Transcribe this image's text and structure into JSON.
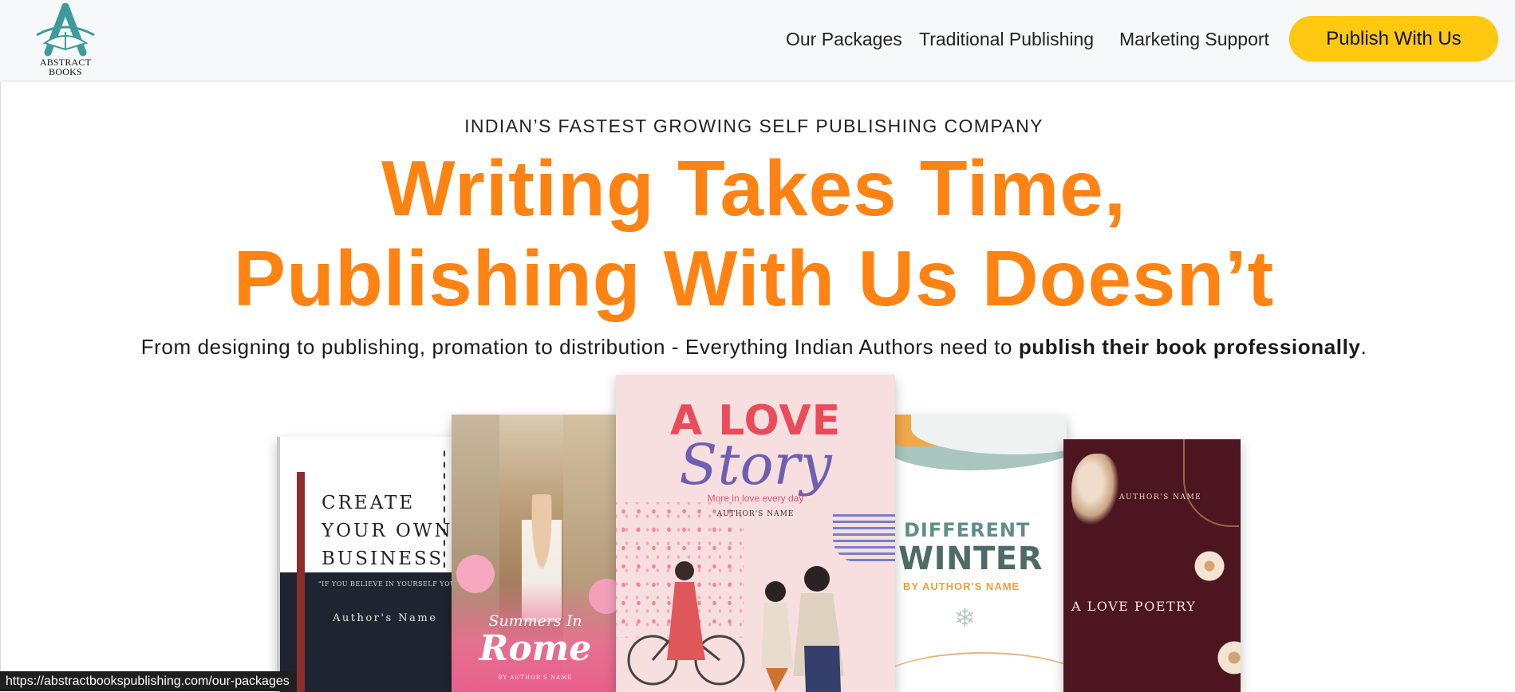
{
  "brand": {
    "logo_line1": "ABSTRACT",
    "logo_line2": "BOOKS",
    "accent": "#3d9b9b"
  },
  "nav": {
    "links": [
      "Our Packages",
      "Traditional Publishing",
      "Marketing Support"
    ],
    "cta": "Publish With Us",
    "cta_color": "#fdc80f"
  },
  "hero": {
    "eyebrow": "INDIAN’S FASTEST GROWING SELF PUBLISHING COMPANY",
    "headline_line1": "Writing Takes Time,",
    "headline_line2": "Publishing With Us Doesn’t",
    "headline_color": "#ff8313",
    "subtext_plain": "From designing to publishing, promation to distribution - Everything Indian Authors need to ",
    "subtext_bold": "publish their book professionally",
    "subtext_end": "."
  },
  "books": {
    "business": {
      "line1": "CREATE",
      "line2": "YOUR OWN",
      "line3": "BUSINESS",
      "quote": "\"IF YOU BELIEVE IN YOURSELF YOU CAN DO IT",
      "author": "Author's Name"
    },
    "rome": {
      "line1": "Summers In",
      "line2": "Rome",
      "author": "BY AUTHOR'S NAME"
    },
    "love_story": {
      "line1": "A LOVE",
      "line2": "Story",
      "tagline": "More in love every day",
      "author": "AUTHOR'S NAME"
    },
    "winter": {
      "line1": "DIFFERENT",
      "line2": "WINTER",
      "author": "BY AUTHOR'S NAME",
      "icon": "snowflake-icon"
    },
    "poetry": {
      "author": "AUTHOR'S NAME",
      "title": "A LOVE POETRY"
    }
  },
  "status": {
    "url": "https://abstractbookspublishing.com/our-packages"
  }
}
